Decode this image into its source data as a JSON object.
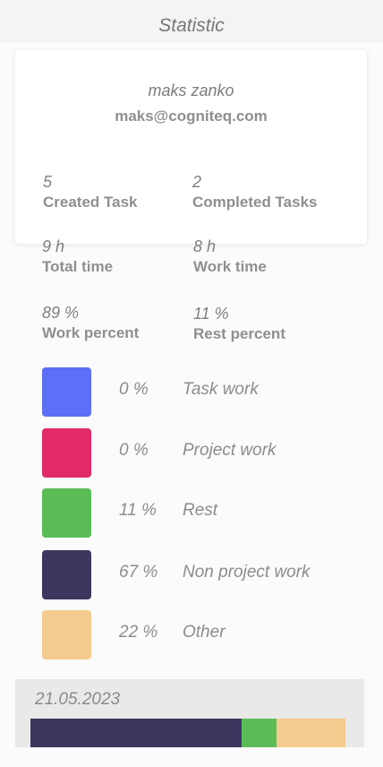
{
  "header": {
    "title": "Statistic"
  },
  "user": {
    "name": "maks zanko",
    "email": "maks@cogniteq.com"
  },
  "stats": {
    "created": {
      "value": "5",
      "label": "Created Task"
    },
    "completed": {
      "value": "2",
      "label": "Completed Tasks"
    },
    "total_time": {
      "value": "9 h",
      "label": "Total time"
    },
    "work_time": {
      "value": "8 h",
      "label": "Work time"
    },
    "work_percent": {
      "value": "89 %",
      "label": "Work percent"
    },
    "rest_percent": {
      "value": "11 %",
      "label": "Rest percent"
    }
  },
  "legend": [
    {
      "percent": "0 %",
      "name": "Task work",
      "color": "#5c6ff6"
    },
    {
      "percent": "0 %",
      "name": "Project work",
      "color": "#e32a68"
    },
    {
      "percent": "11 %",
      "name": "Rest",
      "color": "#5bbc57"
    },
    {
      "percent": "67 %",
      "name": "Non project work",
      "color": "#3b375f"
    },
    {
      "percent": "22 %",
      "name": "Other",
      "color": "#f4cb8f"
    }
  ],
  "day": {
    "date": "21.05.2023",
    "segments": [
      {
        "name": "Non project work",
        "fraction": 0.67,
        "color": "#3b375f"
      },
      {
        "name": "Rest",
        "fraction": 0.11,
        "color": "#5bbc57"
      },
      {
        "name": "Other",
        "fraction": 0.22,
        "color": "#f4cb8f"
      }
    ]
  }
}
